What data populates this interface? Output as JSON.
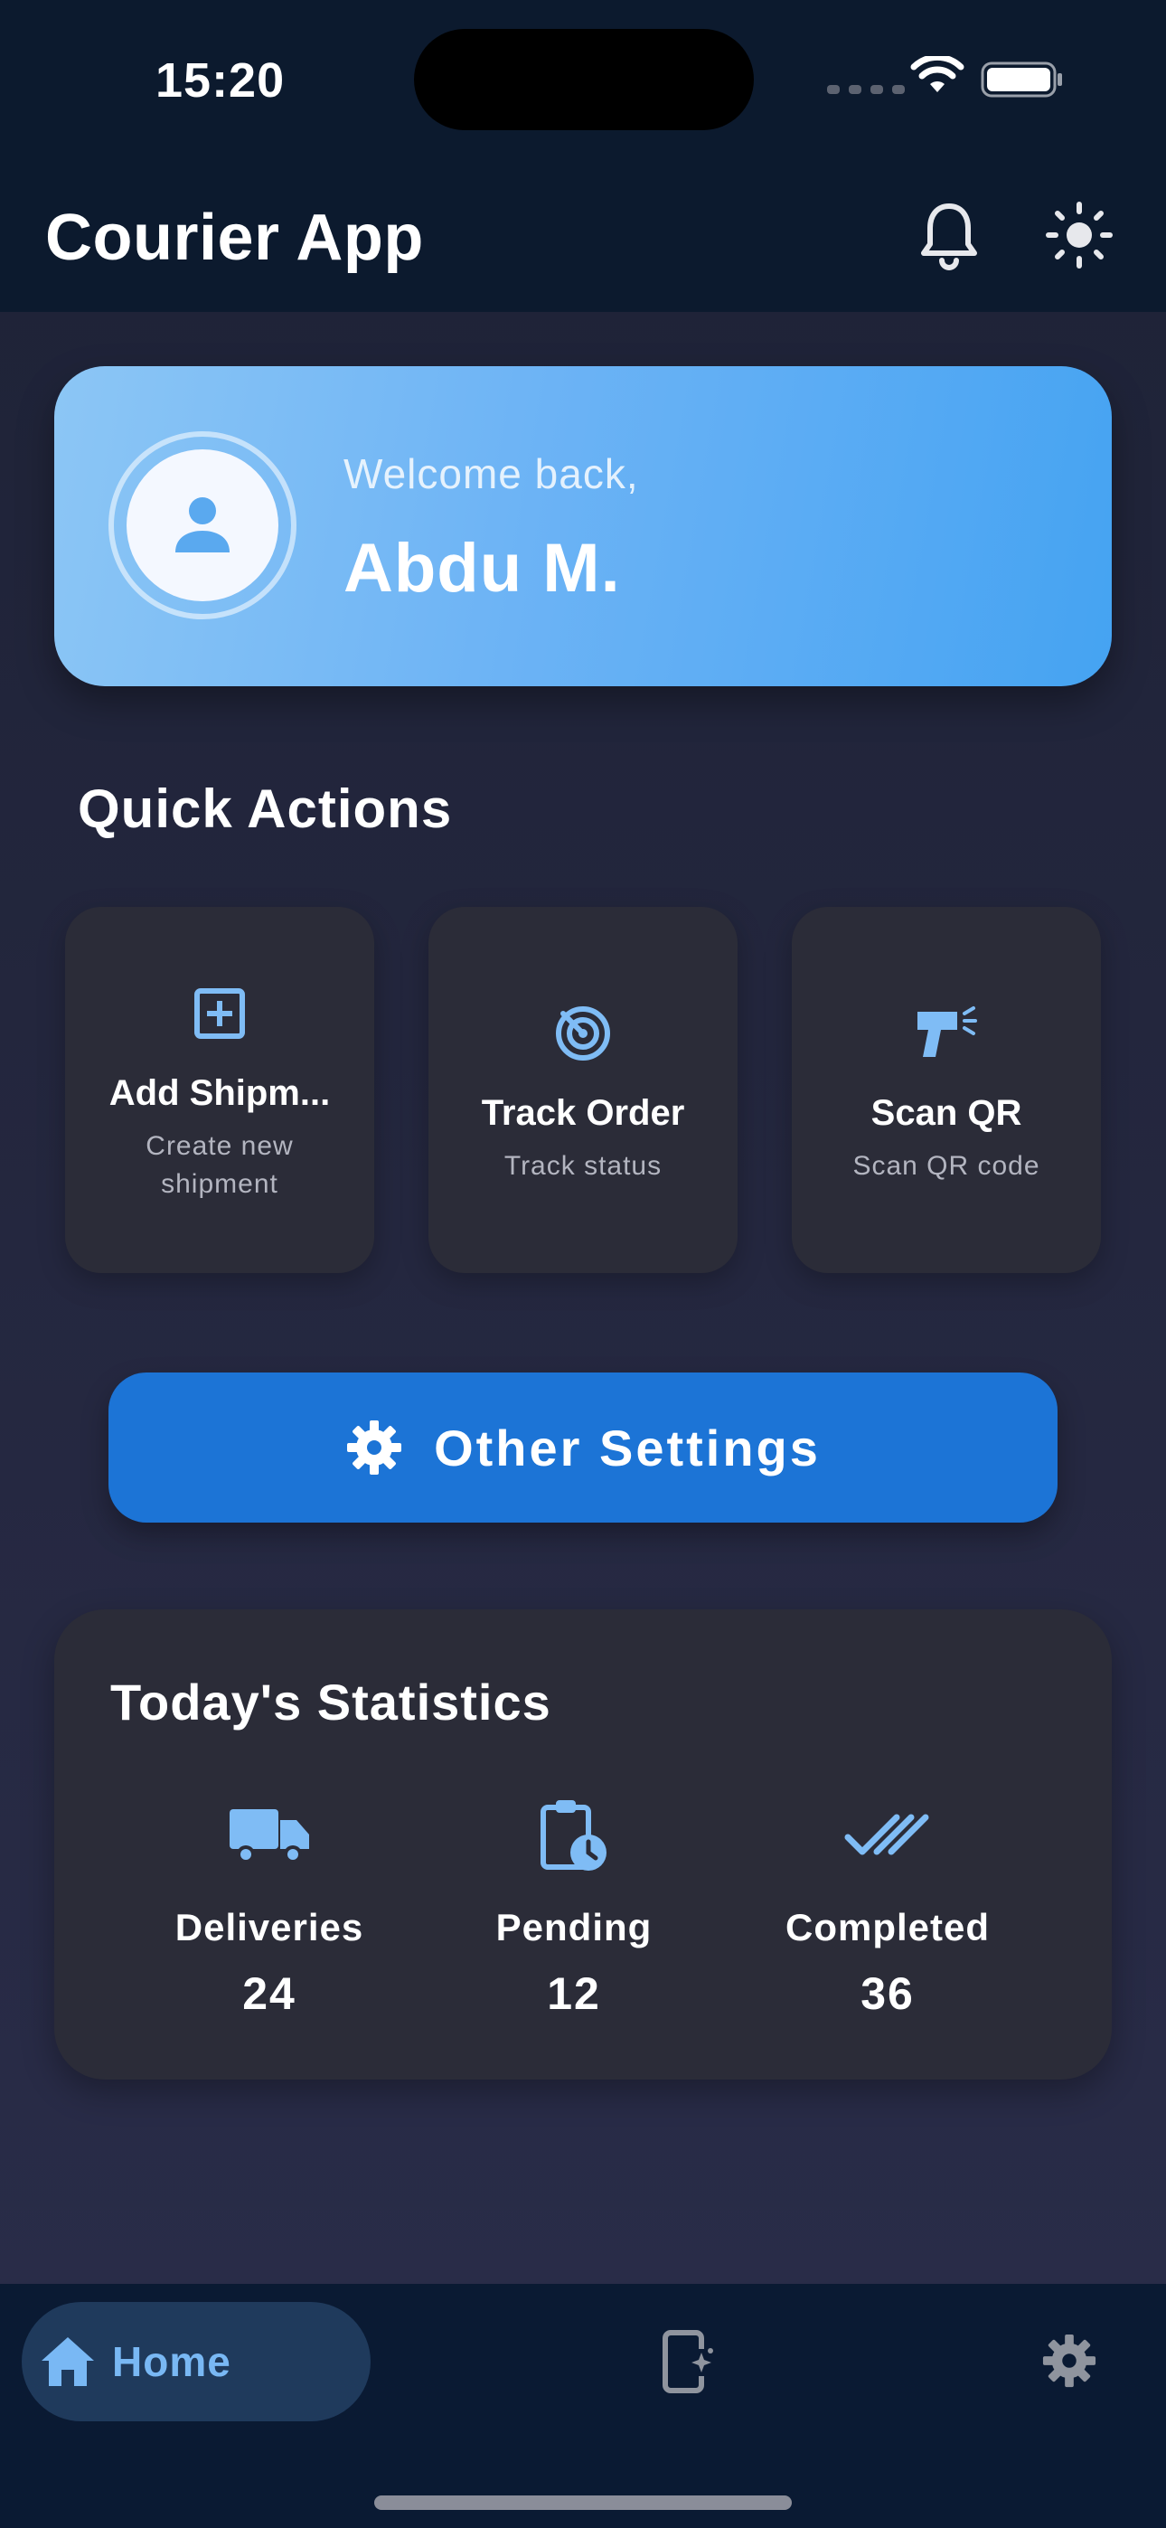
{
  "status_bar": {
    "time": "15:20"
  },
  "app_bar": {
    "title": "Courier App",
    "icons": [
      "bell-icon",
      "sun-icon"
    ]
  },
  "welcome": {
    "greeting": "Welcome back,",
    "user_name": "Abdu M.",
    "avatar_icon": "person-icon"
  },
  "quick_actions": {
    "title": "Quick Actions",
    "items": [
      {
        "title": "Add Shipm...",
        "subtitle": "Create new shipment",
        "icon": "add-box-icon"
      },
      {
        "title": "Track Order",
        "subtitle": "Track status",
        "icon": "radar-icon"
      },
      {
        "title": "Scan QR",
        "subtitle": "Scan QR code",
        "icon": "barcode-scanner-icon"
      }
    ]
  },
  "settings_button": {
    "label": "Other Settings",
    "icon": "gear-icon"
  },
  "statistics": {
    "title": "Today's Statistics",
    "items": [
      {
        "label": "Deliveries",
        "value": "24",
        "icon": "truck-icon"
      },
      {
        "label": "Pending",
        "value": "12",
        "icon": "clipboard-clock-icon"
      },
      {
        "label": "Completed",
        "value": "36",
        "icon": "double-check-icon"
      }
    ]
  },
  "bottom_nav": {
    "items": [
      {
        "label": "Home",
        "icon": "home-icon",
        "active": true
      },
      {
        "label": "",
        "icon": "phone-sparkle-icon",
        "active": false
      },
      {
        "label": "",
        "icon": "gear-icon",
        "active": false
      }
    ]
  },
  "colors": {
    "accent": "#1c74d6",
    "icon_blue": "#7fbcf5",
    "card_bg": "#2b2c38",
    "bar_bg": "#0c1a2e"
  }
}
